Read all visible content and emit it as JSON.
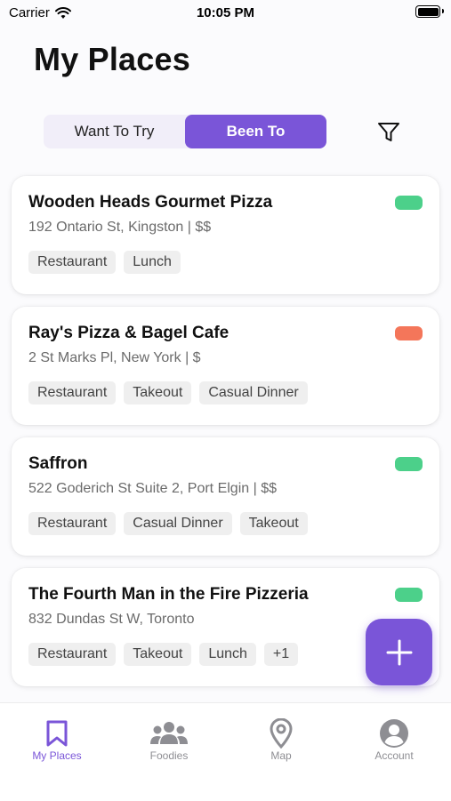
{
  "status_bar": {
    "carrier": "Carrier",
    "time": "10:05 PM"
  },
  "header": {
    "title": "My Places"
  },
  "segments": [
    {
      "label": "Want To Try",
      "active": false
    },
    {
      "label": "Been To",
      "active": true
    }
  ],
  "places": [
    {
      "name": "Wooden Heads Gourmet Pizza",
      "address": "192 Ontario St, Kingston | $$",
      "status_color": "#4cd08a",
      "tags": [
        "Restaurant",
        "Lunch"
      ]
    },
    {
      "name": "Ray's Pizza & Bagel Cafe",
      "address": "2 St Marks Pl, New York | $",
      "status_color": "#f4765a",
      "tags": [
        "Restaurant",
        "Takeout",
        "Casual Dinner"
      ]
    },
    {
      "name": "Saffron",
      "address": "522 Goderich St Suite 2, Port Elgin | $$",
      "status_color": "#4cd08a",
      "tags": [
        "Restaurant",
        "Casual Dinner",
        "Takeout"
      ]
    },
    {
      "name": "The Fourth Man in the Fire Pizzeria",
      "address": "832 Dundas St W, Toronto",
      "status_color": "#4cd08a",
      "tags": [
        "Restaurant",
        "Takeout",
        "Lunch",
        "+1"
      ]
    }
  ],
  "tab_bar": {
    "items": [
      {
        "label": "My Places",
        "icon": "bookmark-icon",
        "active": true
      },
      {
        "label": "Foodies",
        "icon": "people-icon",
        "active": false
      },
      {
        "label": "Map",
        "icon": "map-pin-icon",
        "active": false
      },
      {
        "label": "Account",
        "icon": "account-icon",
        "active": false
      }
    ]
  },
  "colors": {
    "accent": "#7a55d8",
    "inactive": "#8e8e93"
  }
}
